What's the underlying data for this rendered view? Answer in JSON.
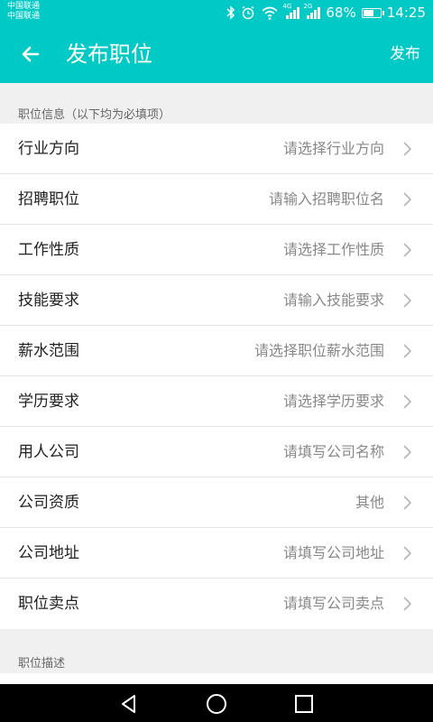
{
  "status_bar": {
    "carrier_1": "中国联通",
    "carrier_2": "中国联通",
    "net_1": "4G",
    "net_2": "2G",
    "battery": "68%",
    "battery_level": 0.68,
    "time": "14:25",
    "icons": [
      "bluetooth-icon",
      "alarm-icon",
      "wifi-icon",
      "signal-icon",
      "signal-icon",
      "battery-icon"
    ]
  },
  "app_bar": {
    "back_icon": "arrow-left-icon",
    "title": "发布职位",
    "action": "发布"
  },
  "section_info": {
    "label": "职位信息（以下均为必填项）"
  },
  "rows": [
    {
      "label": "行业方向",
      "value": "请选择行业方向"
    },
    {
      "label": "招聘职位",
      "value": "请输入招聘职位名"
    },
    {
      "label": "工作性质",
      "value": "请选择工作性质"
    },
    {
      "label": "技能要求",
      "value": "请输入技能要求"
    },
    {
      "label": "薪水范围",
      "value": "请选择职位薪水范围"
    },
    {
      "label": "学历要求",
      "value": "请选择学历要求"
    },
    {
      "label": "用人公司",
      "value": "请填写公司名称"
    },
    {
      "label": "公司资质",
      "value": "其他"
    },
    {
      "label": "公司地址",
      "value": "请填写公司地址"
    },
    {
      "label": "职位卖点",
      "value": "请填写公司卖点"
    }
  ],
  "section_desc": {
    "label": "职位描述"
  },
  "colors": {
    "accent": "#00c9c6",
    "background": "#f0f0f0",
    "navbar": "#000000"
  }
}
